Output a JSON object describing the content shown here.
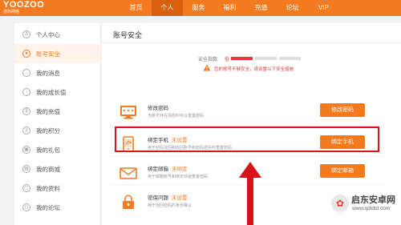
{
  "logo": {
    "main": "YOOZOO",
    "sub": "游族网络"
  },
  "nav": [
    "首页",
    "个人",
    "服务",
    "福利",
    "充值",
    "论坛",
    "VIP"
  ],
  "nav_active_index": 1,
  "sidebar": {
    "items": [
      {
        "label": "个人中心",
        "icon": "user-icon",
        "glyph": "♙"
      },
      {
        "label": "账号安全",
        "icon": "shield-lock-icon",
        "glyph": "●",
        "active": true
      },
      {
        "label": "我的消息",
        "icon": "chat-icon",
        "glyph": "…"
      },
      {
        "label": "我的成长值",
        "icon": "growth-icon",
        "glyph": "↑"
      },
      {
        "label": "我的充值",
        "icon": "recharge-icon",
        "glyph": "$"
      },
      {
        "label": "我的积分",
        "icon": "points-icon",
        "glyph": "≡"
      },
      {
        "label": "我的礼包",
        "icon": "gift-icon",
        "glyph": "▣"
      },
      {
        "label": "我的商城",
        "icon": "store-icon",
        "glyph": "▤"
      },
      {
        "label": "我的资料",
        "icon": "profile-icon",
        "glyph": "▢"
      },
      {
        "label": "我的论坛",
        "icon": "forum-icon",
        "glyph": "◻"
      }
    ]
  },
  "main": {
    "title": "账号安全",
    "security": {
      "label": "安全指数:",
      "value": "低",
      "levels_filled": 1,
      "levels_total": 3,
      "warning": "您的账号不够安全，请设置以下安全措施"
    },
    "rows": [
      {
        "title": "修改密码",
        "status": "",
        "desc": "当账号存在风险时可以重置密码",
        "button": "修改密码",
        "icon": "monitor-icon"
      },
      {
        "title": "绑定手机",
        "status": "未设置",
        "desc": "用于密码找回和找回账号和密码遗失时重置密码",
        "button": "绑定手机",
        "icon": "phone-icon"
      },
      {
        "title": "绑定邮箱",
        "status": "未绑定",
        "desc": "用于邮箱账号和绑定快速重置密码",
        "button": "绑定邮箱",
        "icon": "mail-icon"
      },
      {
        "title": "密保问题",
        "status": "未设置",
        "desc": "用于找回密码的身份确认",
        "button": "",
        "icon": "lock-icon"
      }
    ]
  },
  "watermark": {
    "title": "启东安卓网",
    "url": "www.qdldtd.com"
  },
  "colors": {
    "brand": "#f47a1f",
    "danger": "#e23b3b",
    "highlight": "#d8141b"
  }
}
